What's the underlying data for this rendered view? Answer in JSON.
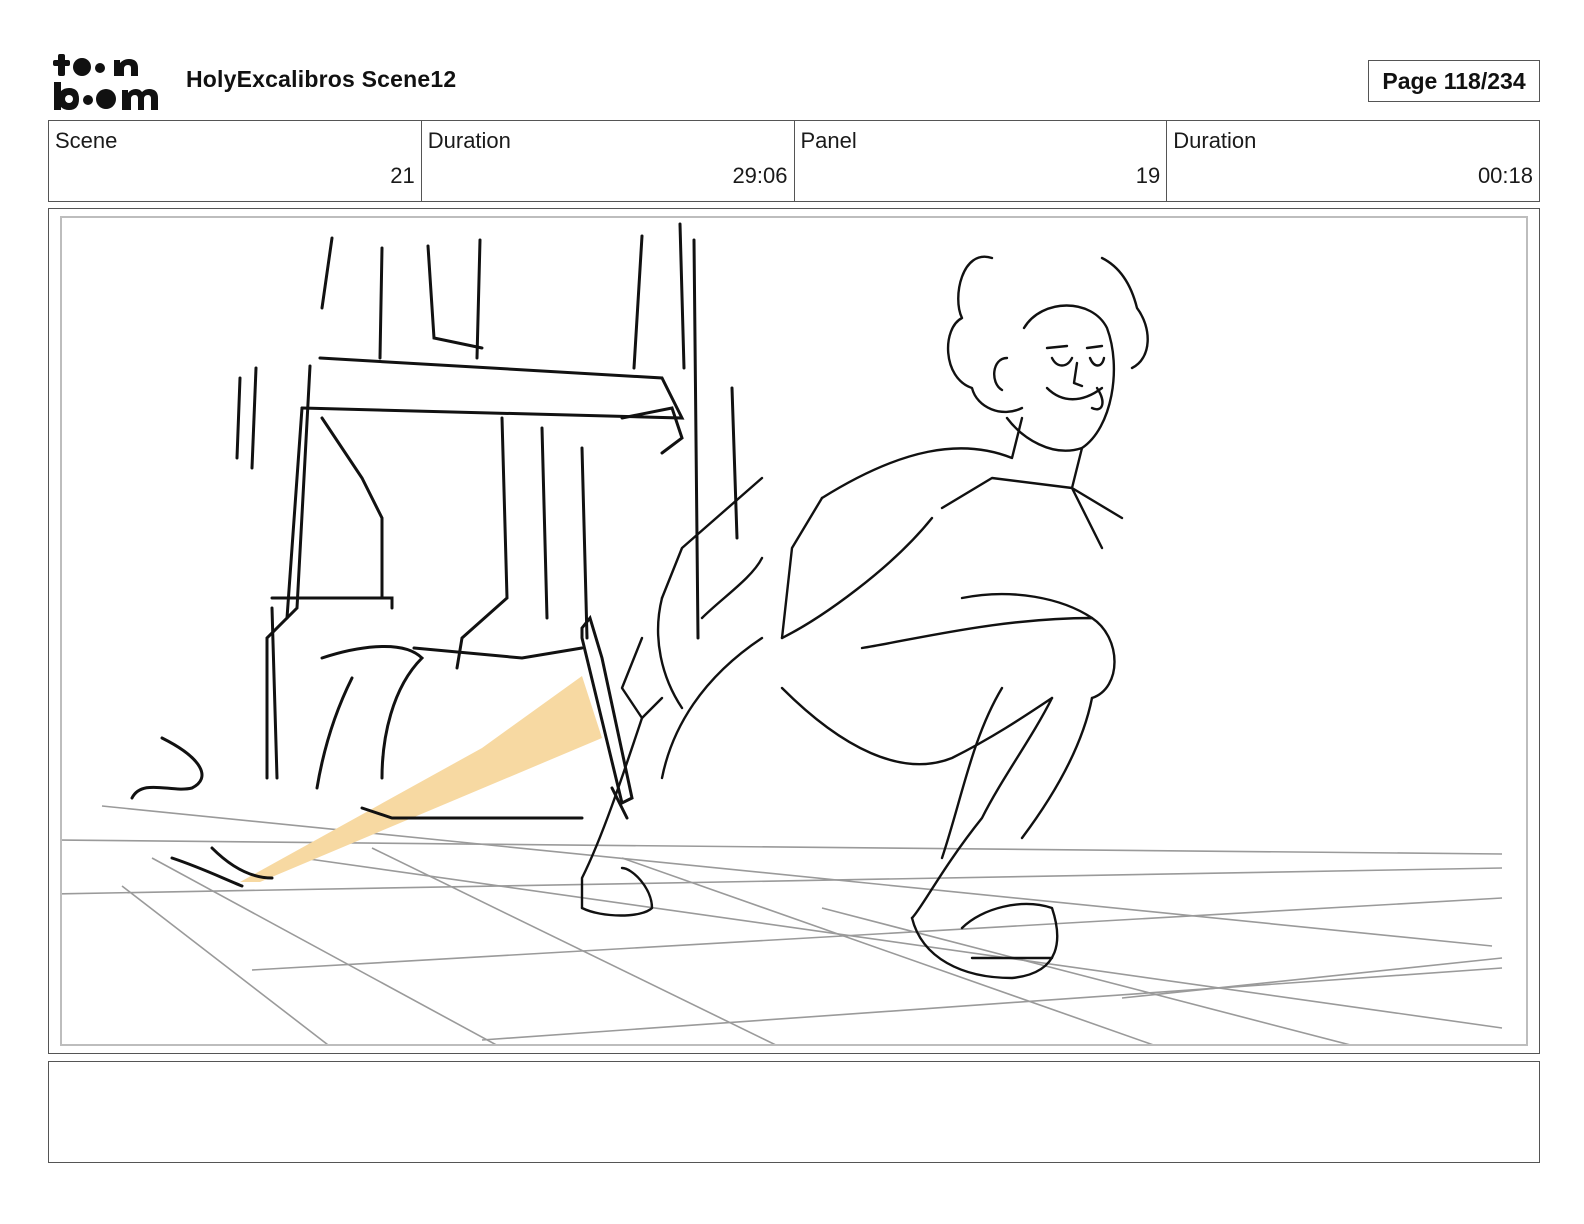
{
  "header": {
    "logo_text_top": "toon",
    "logo_text_bottom": "boom",
    "project_title": "HolyExcalibros Scene12",
    "page_counter": "Page 118/234"
  },
  "info_table": [
    {
      "label": "Scene",
      "value": "21"
    },
    {
      "label": "Duration",
      "value": "29:06"
    },
    {
      "label": "Panel",
      "value": "19"
    },
    {
      "label": "Duration",
      "value": "00:18"
    }
  ],
  "panel": {
    "colors": {
      "ink": "#111111",
      "floor_lines": "#9a9a9a",
      "sword_glow": "#f7d9a2"
    }
  },
  "notes": {
    "text": ""
  }
}
